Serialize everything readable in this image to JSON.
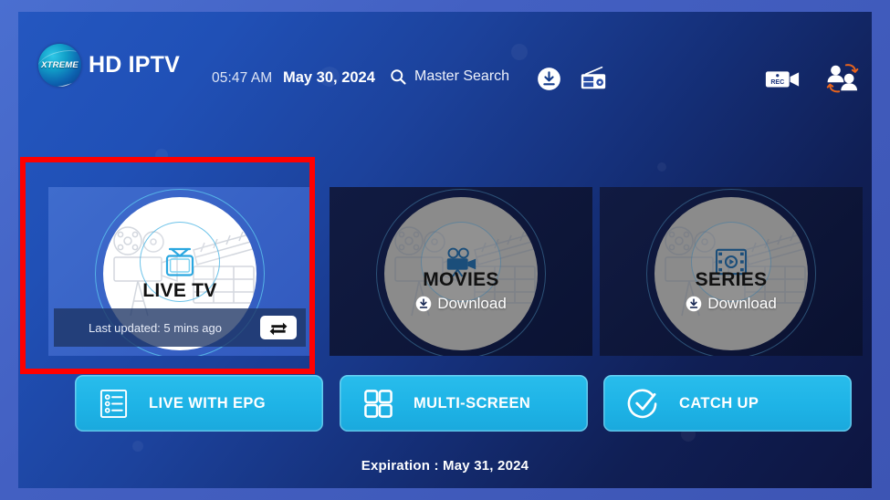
{
  "app": {
    "logo_mark": "XTREME",
    "brand_title": "HD IPTV",
    "logo_icon": "xtreme-sphere-logo"
  },
  "header": {
    "time": "05:47 AM",
    "date": "May 30, 2024",
    "search_label": "Master Search",
    "search_icon": "search-icon",
    "icons": [
      {
        "name": "download-icon",
        "label": "Download"
      },
      {
        "name": "radio-icon",
        "label": "Radio"
      },
      {
        "name": "rec-icon",
        "label": "REC"
      },
      {
        "name": "switch-user-icon",
        "label": "Switch User"
      }
    ],
    "rec_label": "REC"
  },
  "cards": [
    {
      "id": "live-tv",
      "title": "LIVE TV",
      "icon": "tv-icon",
      "focused": true,
      "footer_text": "Last updated: 5 mins ago",
      "footer_button_icon": "refresh-loop-icon"
    },
    {
      "id": "movies",
      "title": "MOVIES",
      "icon": "movie-camera-icon",
      "focused": false,
      "sub_label": "Download",
      "sub_icon": "download-circle-icon"
    },
    {
      "id": "series",
      "title": "SERIES",
      "icon": "film-strip-icon",
      "focused": false,
      "sub_label": "Download",
      "sub_icon": "download-circle-icon"
    }
  ],
  "buttons": [
    {
      "id": "live-with-epg",
      "label": "LIVE WITH EPG",
      "icon": "epg-list-icon"
    },
    {
      "id": "multi-screen",
      "label": "MULTI-SCREEN",
      "icon": "grid-four-icon"
    },
    {
      "id": "catch-up",
      "label": "CATCH UP",
      "icon": "check-circle-icon"
    }
  ],
  "footer": {
    "expiration": "Expiration : May 31, 2024"
  },
  "colors": {
    "accent_cyan": "#1eb3e6",
    "bg_blue": "#2457c0",
    "bg_navy": "#0d1540",
    "annotation_red": "#ff0000",
    "card_focus_blue": "#3f6ccd"
  }
}
